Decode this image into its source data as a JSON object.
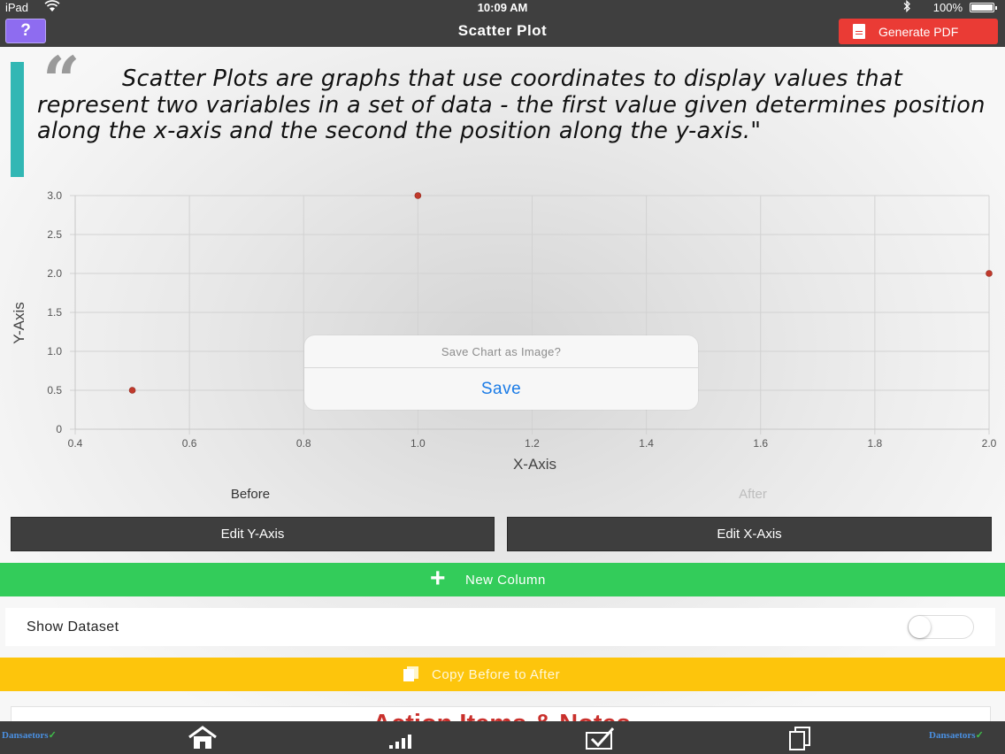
{
  "status_bar": {
    "carrier": "iPad",
    "time": "10:09 AM",
    "battery": "100%"
  },
  "nav": {
    "help_label": "?",
    "title": "Scatter Plot",
    "generate_pdf_label": "Generate PDF"
  },
  "quote": {
    "open_mark": "“",
    "text": "Scatter Plots are graphs that use coordinates to display values that represent two variables in a set of data - the first value given determines position along the x-axis and the second the position along the y-axis.\""
  },
  "chart_data": {
    "type": "scatter",
    "title": "",
    "xlabel": "X-Axis",
    "ylabel": "Y-Axis",
    "xlim": [
      0.4,
      2.0
    ],
    "ylim": [
      0,
      3.0
    ],
    "x_ticks": [
      "0.4",
      "0.6",
      "0.8",
      "1.0",
      "1.2",
      "1.4",
      "1.6",
      "1.8",
      "2.0"
    ],
    "y_ticks": [
      "0",
      "0.5",
      "1.0",
      "1.5",
      "2.0",
      "2.5",
      "3.0"
    ],
    "grid": true,
    "point_color": "#c0392b",
    "points": [
      {
        "x": 0.5,
        "y": 0.5
      },
      {
        "x": 1.0,
        "y": 3.0
      },
      {
        "x": 2.0,
        "y": 2.0
      }
    ]
  },
  "tabs": {
    "before": "Before",
    "after": "After"
  },
  "buttons": {
    "edit_y": "Edit Y-Axis",
    "edit_x": "Edit X-Axis",
    "new_column": "New Column",
    "copy_before_to_after": "Copy Before to After"
  },
  "dataset": {
    "label": "Show Dataset",
    "enabled": false
  },
  "notes": {
    "title": "Action Items & Notes"
  },
  "tab_bar": {
    "brand_text": "Dansaetors",
    "brand_mark": "✓",
    "icons": [
      "home-icon",
      "signal-bars-icon",
      "checkbox-icon",
      "copy-icon"
    ]
  },
  "dialog": {
    "message": "Save Chart as Image?",
    "action": "Save"
  },
  "colors": {
    "teal_accent": "#32b7b4",
    "green_button": "#33cc5a",
    "yellow_button": "#fdc50c",
    "pdf_red": "#ea3b35",
    "help_purple": "#8e6cf0",
    "ios_blue": "#1a7be6"
  }
}
